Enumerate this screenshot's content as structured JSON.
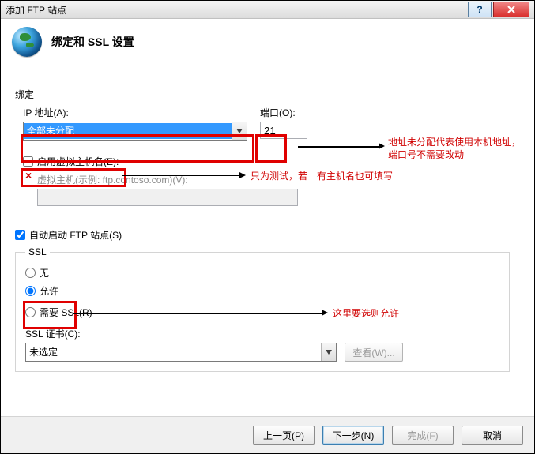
{
  "window": {
    "title": "添加 FTP 站点"
  },
  "header": {
    "title": "绑定和 SSL 设置"
  },
  "binding": {
    "section_label": "绑定",
    "ip_label": "IP 地址(A):",
    "ip_value": "全部未分配",
    "port_label": "端口(O):",
    "port_value": "21",
    "enable_vhost_label": "启用虚拟主机名(E):",
    "vhost_hint_label": "虚拟主机(示例: ftp.contoso.com)(V):",
    "vhost_value": ""
  },
  "autostart": {
    "label": "自动启动 FTP 站点(S)",
    "checked": true
  },
  "ssl": {
    "legend": "SSL",
    "none_label": "无",
    "allow_label": "允许",
    "require_label": "需要 SSL(R)",
    "selected": "allow",
    "cert_label": "SSL 证书(C):",
    "cert_value": "未选定",
    "view_label": "查看(W)..."
  },
  "footer": {
    "prev": "上一页(P)",
    "next": "下一步(N)",
    "finish": "完成(F)",
    "cancel": "取消"
  },
  "annotations": {
    "ip_port_note": "地址未分配代表使用本机地址，端口号不需要改动",
    "vhost_note": "只为测试，若　有主机名也可填写",
    "ssl_note": "这里要选则允许"
  }
}
